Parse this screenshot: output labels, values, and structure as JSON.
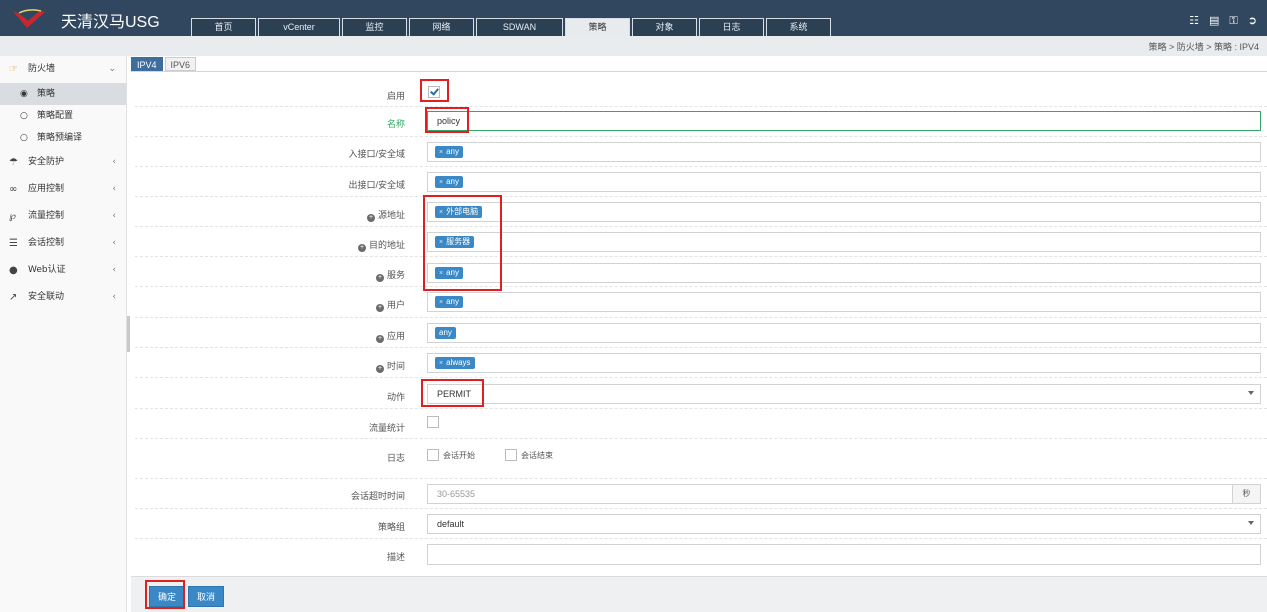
{
  "header": {
    "title": "天清汉马USG",
    "nav_tabs": [
      {
        "label": "首页"
      },
      {
        "label": "vCenter"
      },
      {
        "label": "监控"
      },
      {
        "label": "网络"
      },
      {
        "label": "SDWAN"
      },
      {
        "label": "策略"
      },
      {
        "label": "对象"
      },
      {
        "label": "日志"
      },
      {
        "label": "系统"
      }
    ],
    "active_tab": "策略",
    "icons": [
      "clipboard-icon",
      "save-icon",
      "key-icon",
      "logout-icon"
    ]
  },
  "breadcrumb": "策略 > 防火墙 > 策略 : IPV4",
  "sidebar": {
    "firewall": {
      "label": "防火墙",
      "icon": "hand-point-icon",
      "sub": [
        {
          "label": "策略"
        },
        {
          "label": "策略配置"
        },
        {
          "label": "策略预编译"
        }
      ]
    },
    "items": [
      {
        "label": "安全防护",
        "icon": "umbrella-icon"
      },
      {
        "label": "应用控制",
        "icon": "link-icon"
      },
      {
        "label": "流量控制",
        "icon": "flow-icon"
      },
      {
        "label": "会话控制",
        "icon": "sliders-icon"
      },
      {
        "label": "Web认证",
        "icon": "globe-icon"
      },
      {
        "label": "安全联动",
        "icon": "external-link-icon"
      }
    ]
  },
  "subtabs": [
    {
      "label": "IPV4"
    },
    {
      "label": "IPV6"
    }
  ],
  "form": {
    "enable": {
      "label": "启用",
      "checked": true
    },
    "name": {
      "label": "名称",
      "value": "policy"
    },
    "ingress": {
      "label": "入接口/安全域",
      "tag": "any"
    },
    "egress": {
      "label": "出接口/安全域",
      "tag": "any"
    },
    "src_addr": {
      "label": "源地址",
      "tag": "外部电脑"
    },
    "dst_addr": {
      "label": "目的地址",
      "tag": "服务器"
    },
    "service": {
      "label": "服务",
      "tag": "any"
    },
    "user": {
      "label": "用户",
      "tag": "any"
    },
    "app": {
      "label": "应用",
      "tag": "any"
    },
    "time": {
      "label": "时间",
      "tag": "always"
    },
    "action": {
      "label": "动作",
      "value": "PERMIT"
    },
    "traffic_stats": {
      "label": "流量统计",
      "checked": false
    },
    "log": {
      "label": "日志",
      "opt_start": "会话开始",
      "opt_end": "会话结束"
    },
    "session_timeout": {
      "label": "会话超时时间",
      "placeholder": "30-65535",
      "unit": "秒"
    },
    "policy_group": {
      "label": "策略组",
      "value": "default"
    },
    "description": {
      "label": "描述",
      "value": ""
    }
  },
  "buttons": {
    "ok": "确定",
    "cancel": "取消"
  },
  "colors": {
    "topbar": "#30475f",
    "accent": "#3a88c5",
    "highlight": "#e02020"
  }
}
